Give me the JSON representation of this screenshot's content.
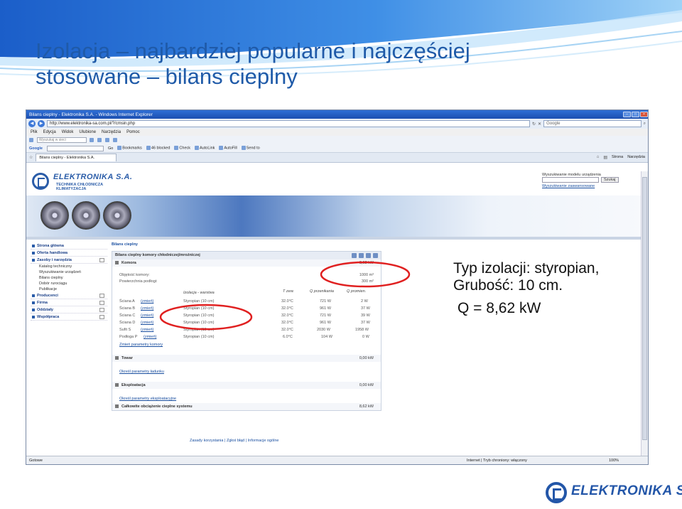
{
  "slide": {
    "title_line1": "Izolacja – najbardziej popularne i najczęściej",
    "title_line2": "stosowane – bilans cieplny",
    "callout_line1": "Typ izolacji: styropian,",
    "callout_line2": "Grubość: 10 cm.",
    "callout_line3": "Q = 8,62 kW",
    "footer_logo_text": "ELEKTRONIKA S.A.",
    "colors": {
      "title": "#1f5aa8",
      "annotation": "#e02020",
      "logo": "#2356a8"
    }
  },
  "browser": {
    "window_title": "Bilans cieplny - Elektronika S.A. - Windows Internet Explorer",
    "address": "http://www.elektronika-sa.com.pl/?/cmsin.php",
    "search_placeholder": "Google",
    "menu": [
      "Plik",
      "Edycja",
      "Widok",
      "Ulubione",
      "Narzędzia",
      "Pomoc"
    ],
    "toolbar1": {
      "search_placeholder": "Wyszukaj w sieci"
    },
    "toolbar2": {
      "google": "Google",
      "go": "Go",
      "bookmarks": "Bookmarks",
      "blocked": "46 blocked",
      "check": "Check",
      "autolink": "AutoLink",
      "autofill": "AutoFill",
      "send_to": "Send to"
    },
    "tab_title": "Bilans cieplny - Elektronika S.A.",
    "tab_tools": [
      "Strona",
      "Narzędzia"
    ],
    "status": {
      "left": "Gotowe",
      "zone": "Internet | Tryb chroniony: włączony",
      "zoom": "100%"
    }
  },
  "site": {
    "logo_name": "ELEKTRONIKA S.A.",
    "logo_tag_line1": "TECHNIKA CHŁODNICZA",
    "logo_tag_line2": "KLIMATYZACJA",
    "search_label": "Wyszukiwanie modelu urządzenia",
    "search_button": "Szukaj",
    "advanced_search": "Wyszukiwanie zaawansowane",
    "sidebar": [
      {
        "label": "Strona główna",
        "type": "main"
      },
      {
        "label": "Oferta handlowa",
        "type": "main"
      },
      {
        "label": "Zasoby i narzędzia",
        "type": "main"
      },
      {
        "label": "Katalog techniczny",
        "type": "sub"
      },
      {
        "label": "Wyszukiwanie urządzeń",
        "type": "sub"
      },
      {
        "label": "Bilans cieplny",
        "type": "sub"
      },
      {
        "label": "Dobór rurociągu",
        "type": "sub"
      },
      {
        "label": "Publikacje",
        "type": "sub"
      },
      {
        "label": "Producenci",
        "type": "main"
      },
      {
        "label": "Firma",
        "type": "main"
      },
      {
        "label": "Oddziały",
        "type": "main"
      },
      {
        "label": "Współpraca",
        "type": "main"
      }
    ],
    "breadcrumb": "Bilans cieplny",
    "panel_title": "Bilans cieplny komory chłodniczej/mroźniczej",
    "komora": {
      "label": "Komora",
      "value": "8,62 kW"
    },
    "volume": {
      "label": "Objętość komory:",
      "value": "1000 m³"
    },
    "area": {
      "label": "Powierzchnia podłogi:",
      "value": "300 m²"
    },
    "grid_headers": {
      "insulation": "Izolacja - warstwa",
      "t_zew": "T zew.",
      "q_przenik": "Q przenikania",
      "q_promien": "Q promien."
    },
    "rows": [
      {
        "name": "Ściana A",
        "change": "(zmień)",
        "insulation": "Styropian (10 cm)",
        "t": "32.0°C",
        "q1": "721 W",
        "q2": "2 W"
      },
      {
        "name": "Ściana B",
        "change": "(zmień)",
        "insulation": "Styropian (10 cm)",
        "t": "32.0°C",
        "q1": "961 W",
        "q2": "37 W"
      },
      {
        "name": "Ściana C",
        "change": "(zmień)",
        "insulation": "Styropian (10 cm)",
        "t": "32.0°C",
        "q1": "721 W",
        "q2": "39 W"
      },
      {
        "name": "Ściana D",
        "change": "(zmień)",
        "insulation": "Styropian (10 cm)",
        "t": "32.0°C",
        "q1": "961 W",
        "q2": "37 W"
      },
      {
        "name": "Sufit S",
        "change": "(zmień)",
        "insulation": "Styropian (10 cm)",
        "t": "32.0°C",
        "q1": "2030 W",
        "q2": "1958 W"
      },
      {
        "name": "Podłoga P",
        "change": "(zmień)",
        "insulation": "Styropian (10 cm)",
        "t": "6.0°C",
        "q1": "104 W",
        "q2": "0 W"
      }
    ],
    "change_params": "Zmień parametry komory",
    "towar": {
      "label": "Towar",
      "value": "0,00 kW"
    },
    "towar_link": "Określ parametry ładunku",
    "eksploatacja": {
      "label": "Eksploatacja",
      "value": "0,00 kW"
    },
    "eksploatacja_link": "Określ parametry eksploatacyjne",
    "total": {
      "label": "Całkowite obciążenie cieplne systemu",
      "value": "8,62 kW"
    },
    "footer": "Zasady korzystania | Zgłoś błąd | Informacje ogólne"
  }
}
